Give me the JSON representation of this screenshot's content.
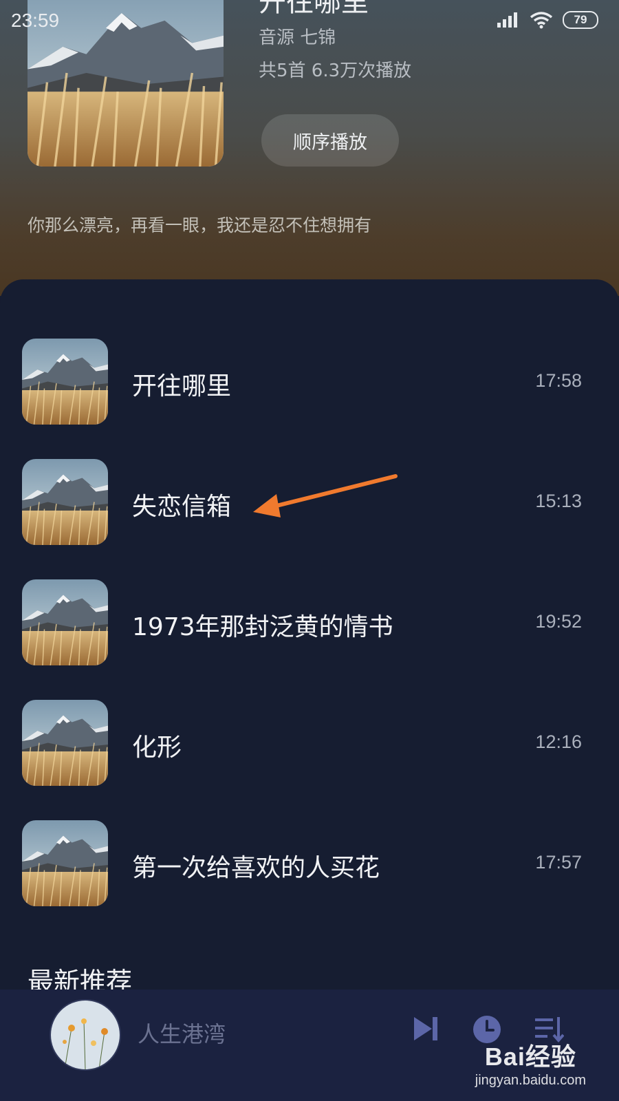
{
  "status_bar": {
    "time": "23:59",
    "battery": "79"
  },
  "album": {
    "title": "开往哪里",
    "source": "音源   七锦",
    "stats": "共5首   6.3万次播放",
    "play_button": "顺序播放",
    "description": "你那么漂亮，再看一眼，我还是忍不住想拥有"
  },
  "songs": [
    {
      "title": "开往哪里",
      "duration": "17:58"
    },
    {
      "title": "失恋信箱",
      "duration": "15:13"
    },
    {
      "title": "1973年那封泛黄的情书",
      "duration": "19:52"
    },
    {
      "title": "化形",
      "duration": "12:16"
    },
    {
      "title": "第一次给喜欢的人买花",
      "duration": "17:57"
    }
  ],
  "sections": {
    "latest_title": "最新推荐"
  },
  "player": {
    "current_title": "人生港湾"
  },
  "watermark": {
    "logo": "Bai经验",
    "url": "jingyan.baidu.com"
  },
  "colors": {
    "accent_arrow": "#f07a2e",
    "panel_bg": "#161d31",
    "player_bg": "#1b2240"
  }
}
